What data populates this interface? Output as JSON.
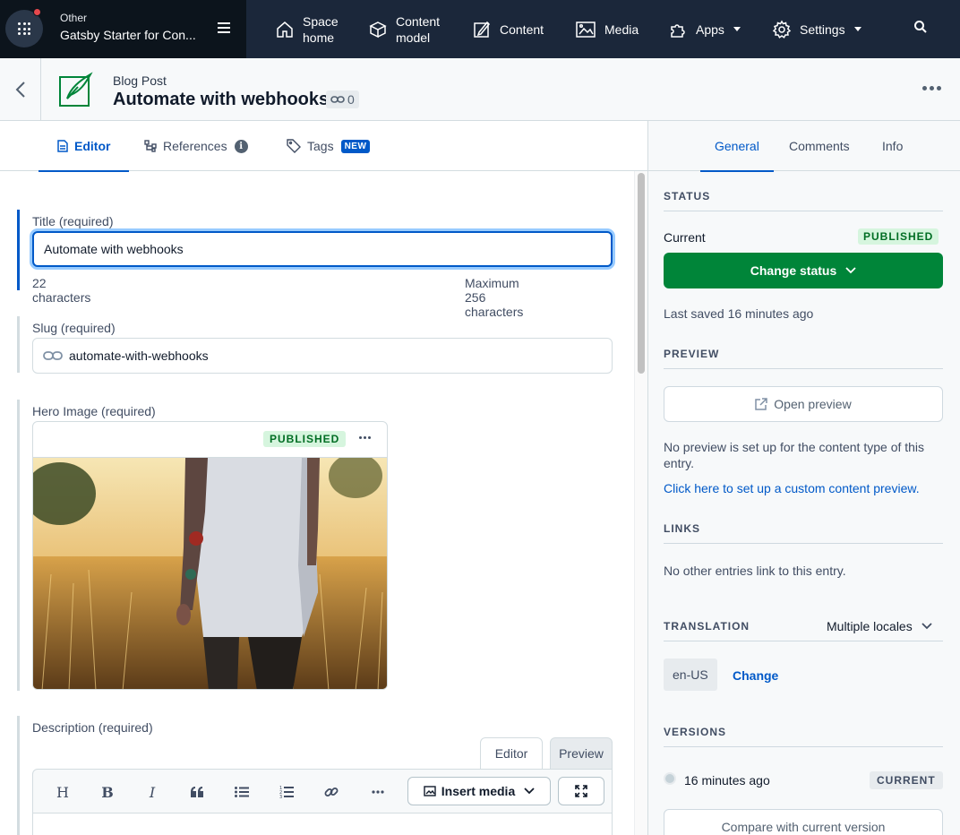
{
  "topnav": {
    "space_env": "Other",
    "space_name": "Gatsby Starter for Con...",
    "items": [
      {
        "line1": "Space",
        "line2": "home",
        "icon": "home-icon"
      },
      {
        "line1": "Content",
        "line2": "model",
        "icon": "content-model-icon"
      },
      {
        "label": "Content",
        "icon": "content-icon"
      },
      {
        "label": "Media",
        "icon": "media-icon"
      },
      {
        "label": "Apps",
        "icon": "apps-icon"
      },
      {
        "label": "Settings",
        "icon": "gear-icon"
      }
    ],
    "search_icon": "search-icon"
  },
  "entry": {
    "content_type": "Blog Post",
    "title": "Automate with webhooks",
    "link_count": "0"
  },
  "left_tabs": {
    "editor": "Editor",
    "references": "References",
    "tags": "Tags",
    "tags_badge": "NEW"
  },
  "fields": {
    "title": {
      "label": "Title (required)",
      "value": "Automate with webhooks",
      "count": "22 characters",
      "max": "Maximum 256 characters"
    },
    "slug": {
      "label": "Slug (required)",
      "value": "automate-with-webhooks"
    },
    "hero": {
      "label": "Hero Image (required)",
      "status": "PUBLISHED"
    },
    "description": {
      "label": "Description (required)",
      "mode_editor": "Editor",
      "mode_preview": "Preview",
      "toolbar": {
        "heading": "H",
        "bold": "B",
        "italic": "I",
        "insert_media": "Insert media"
      }
    }
  },
  "sidebar": {
    "tabs": {
      "general": "General",
      "comments": "Comments",
      "info": "Info"
    },
    "status": {
      "heading": "STATUS",
      "current_label": "Current",
      "current_badge": "PUBLISHED",
      "change_button": "Change status",
      "last_saved": "Last saved 16 minutes ago"
    },
    "preview": {
      "heading": "PREVIEW",
      "open_button": "Open preview",
      "note": "No preview is set up for the content type of this entry.",
      "setup_link": "Click here to set up a custom content preview."
    },
    "links": {
      "heading": "LINKS",
      "note": "No other entries link to this entry."
    },
    "translation": {
      "heading": "TRANSLATION",
      "mode": "Multiple locales",
      "locale": "en-US",
      "change_link": "Change"
    },
    "versions": {
      "heading": "VERSIONS",
      "time": "16 minutes ago",
      "badge": "CURRENT",
      "compare_button": "Compare with current version"
    }
  },
  "colors": {
    "nav_bg": "#1b273a",
    "accent": "#0059c8",
    "success": "#008539"
  }
}
